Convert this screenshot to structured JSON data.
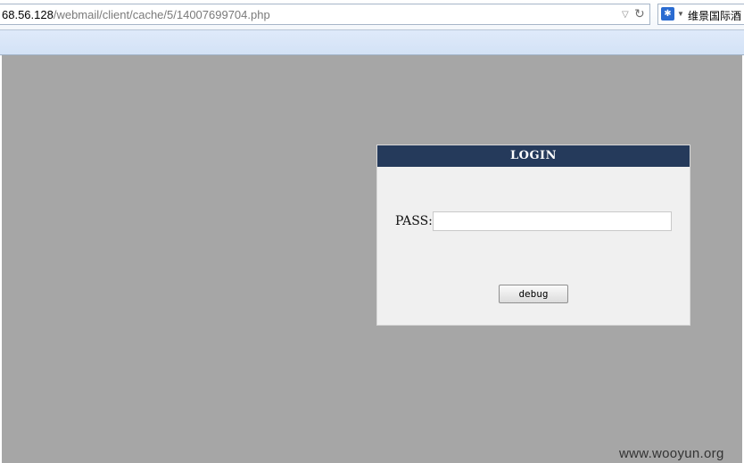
{
  "address_bar": {
    "url_host": "68.56.128",
    "url_path": "/webmail/client/cache/5/14007699704.php",
    "dropdown_icon": "▽",
    "reload_icon": "↻"
  },
  "search_bar": {
    "engine_icon": "paw-icon",
    "engine_glyph": "🐾",
    "text": "维景国际酒"
  },
  "login": {
    "title": "LOGIN",
    "pass_label": "PASS:",
    "pass_value": "",
    "button_label": "debug"
  },
  "watermark": "www.wooyun.org",
  "colors": {
    "page_background": "#a6a6a6",
    "panel_background": "#f0f0f0",
    "title_bar": "#253a5b"
  }
}
